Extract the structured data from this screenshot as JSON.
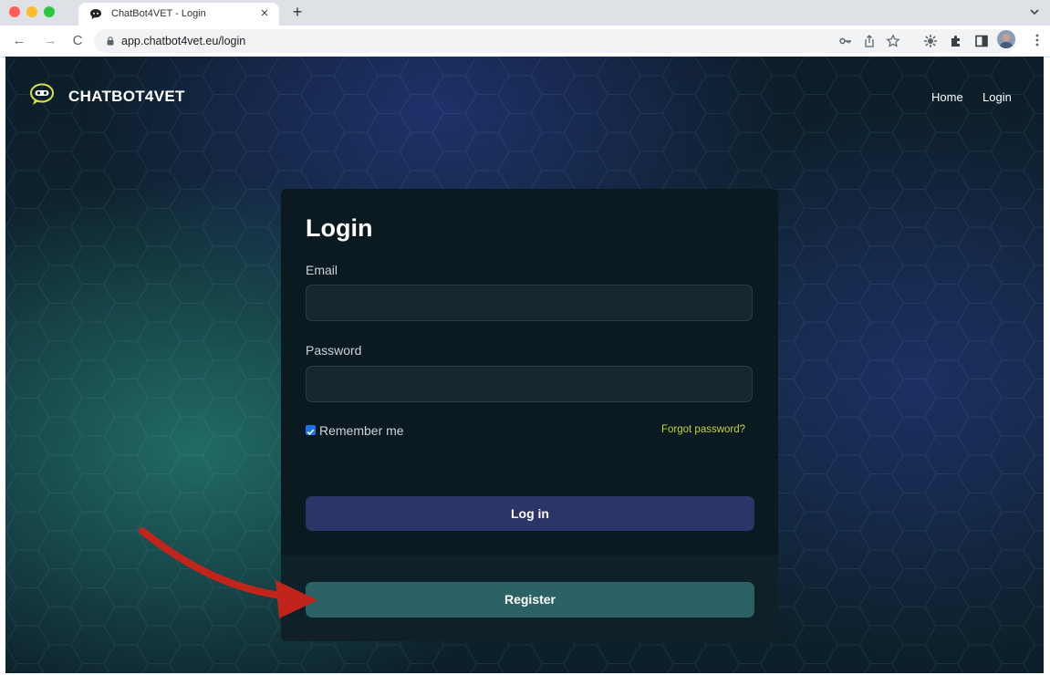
{
  "browser": {
    "tab_title": "ChatBot4VET - Login",
    "tab_close": "×",
    "new_tab": "+",
    "url": "app.chatbot4vet.eu/login",
    "nav_back": "←",
    "nav_forward": "→",
    "nav_reload": "C"
  },
  "header": {
    "brand": "CHATBOT4VET",
    "nav": [
      "Home",
      "Login"
    ]
  },
  "login_card": {
    "title": "Login",
    "email_label": "Email",
    "email_value": "",
    "password_label": "Password",
    "password_value": "",
    "remember_label": "Remember me",
    "remember_checked": true,
    "forgot_link": "Forgot password?",
    "login_button": "Log in",
    "register_button": "Register"
  },
  "colors": {
    "card_bg": "#0b1a21",
    "login_button": "#2b3567",
    "register_button": "#2c6265",
    "forgot_link": "#c2d23c",
    "annotation_arrow": "#c0241b"
  },
  "icons": [
    "chat-bubble-icon",
    "lock-icon",
    "key-icon",
    "share-icon",
    "star-icon",
    "extension-icon",
    "puzzle-icon",
    "sidepanel-icon",
    "avatar",
    "kebab-menu-icon",
    "chevron-down-icon",
    "annotation-arrow"
  ]
}
